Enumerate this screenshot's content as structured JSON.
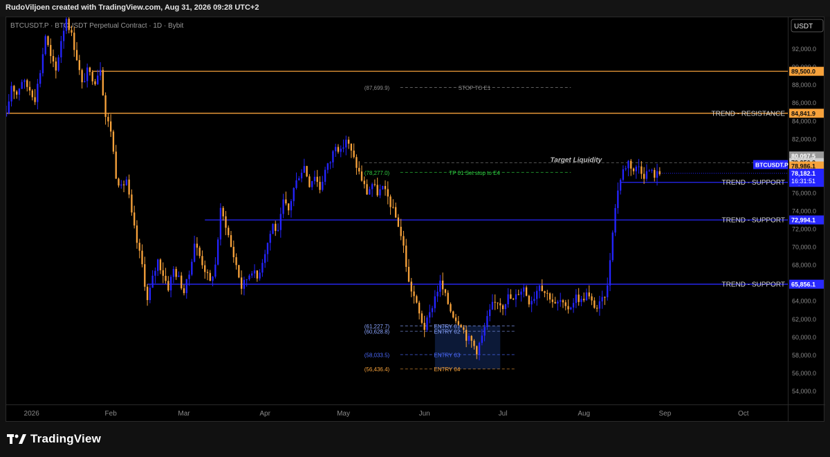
{
  "header": {
    "attribution": "RudoViljoen created with TradingView.com, Aug 31, 2026 09:28 UTC+2",
    "symbol_line": "BTCUSDT.P · BTCUSDT Perpetual Contract · 1D · Bybit"
  },
  "footer": {
    "brand": "TradingView"
  },
  "chart_data": {
    "type": "candlestick",
    "currency": "USDT",
    "ylim": [
      52500,
      95500
    ],
    "y_ticks": [
      54000,
      56000,
      58000,
      60000,
      62000,
      64000,
      66000,
      68000,
      70000,
      72000,
      74000,
      76000,
      78000,
      80000,
      82000,
      84000,
      86000,
      88000,
      90000,
      92000
    ],
    "x_labels": [
      {
        "label": "2026",
        "x": 0.7
      },
      {
        "label": "Feb",
        "x": 31
      },
      {
        "label": "Mar",
        "x": 59
      },
      {
        "label": "Apr",
        "x": 90
      },
      {
        "label": "May",
        "x": 120
      },
      {
        "label": "Jun",
        "x": 151
      },
      {
        "label": "Jul",
        "x": 181
      },
      {
        "label": "Aug",
        "x": 212
      },
      {
        "label": "Sep",
        "x": 243
      },
      {
        "label": "Oct",
        "x": 273
      }
    ],
    "x_range": [
      -9,
      290
    ],
    "last_bar_x": 241,
    "colors": {
      "up": "#2424ff",
      "down": "#f7a23b",
      "resistance": "#f7a23b",
      "support": "#2929ff"
    },
    "price_path": [
      [
        -9,
        84500
      ],
      [
        -7,
        88000
      ],
      [
        -5,
        87000
      ],
      [
        -3,
        88500
      ],
      [
        0,
        87500
      ],
      [
        2,
        86500
      ],
      [
        4,
        89500
      ],
      [
        6,
        93500
      ],
      [
        8,
        91000
      ],
      [
        10,
        89500
      ],
      [
        12,
        93000
      ],
      [
        14,
        95500
      ],
      [
        16,
        93500
      ],
      [
        18,
        91000
      ],
      [
        20,
        88000
      ],
      [
        22,
        89500
      ],
      [
        25,
        88500
      ],
      [
        27,
        90000
      ],
      [
        29,
        84500
      ],
      [
        31,
        83000
      ],
      [
        33,
        78000
      ],
      [
        35,
        76500
      ],
      [
        37,
        77500
      ],
      [
        39,
        73500
      ],
      [
        41,
        70500
      ],
      [
        43,
        68000
      ],
      [
        45,
        64000
      ],
      [
        47,
        66500
      ],
      [
        49,
        68500
      ],
      [
        51,
        67000
      ],
      [
        53,
        65500
      ],
      [
        55,
        67500
      ],
      [
        57,
        66500
      ],
      [
        59,
        65000
      ],
      [
        61,
        67000
      ],
      [
        63,
        70500
      ],
      [
        65,
        69000
      ],
      [
        67,
        67500
      ],
      [
        69,
        66000
      ],
      [
        71,
        68000
      ],
      [
        73,
        74000
      ],
      [
        75,
        72500
      ],
      [
        77,
        70000
      ],
      [
        79,
        68000
      ],
      [
        81,
        65500
      ],
      [
        83,
        66500
      ],
      [
        85,
        67500
      ],
      [
        87,
        66500
      ],
      [
        89,
        68500
      ],
      [
        91,
        70500
      ],
      [
        93,
        72500
      ],
      [
        95,
        71500
      ],
      [
        97,
        75000
      ],
      [
        99,
        74000
      ],
      [
        101,
        76500
      ],
      [
        103,
        78000
      ],
      [
        105,
        79000
      ],
      [
        107,
        77000
      ],
      [
        109,
        78000
      ],
      [
        111,
        76500
      ],
      [
        113,
        78500
      ],
      [
        115,
        79500
      ],
      [
        117,
        81500
      ],
      [
        119,
        80500
      ],
      [
        121,
        82000
      ],
      [
        123,
        80500
      ],
      [
        125,
        79000
      ],
      [
        127,
        77500
      ],
      [
        129,
        76000
      ],
      [
        131,
        77000
      ],
      [
        133,
        76000
      ],
      [
        135,
        76500
      ],
      [
        137,
        75500
      ],
      [
        139,
        74000
      ],
      [
        141,
        72500
      ],
      [
        143,
        70000
      ],
      [
        145,
        66000
      ],
      [
        147,
        64500
      ],
      [
        149,
        62500
      ],
      [
        151,
        61000
      ],
      [
        153,
        62500
      ],
      [
        155,
        64500
      ],
      [
        157,
        66000
      ],
      [
        159,
        64500
      ],
      [
        161,
        63000
      ],
      [
        163,
        62000
      ],
      [
        165,
        61500
      ],
      [
        167,
        60000
      ],
      [
        169,
        59500
      ],
      [
        171,
        58500
      ],
      [
        173,
        60000
      ],
      [
        175,
        62000
      ],
      [
        177,
        63500
      ],
      [
        179,
        64000
      ],
      [
        181,
        63500
      ],
      [
        183,
        64500
      ],
      [
        185,
        64000
      ],
      [
        187,
        65000
      ],
      [
        189,
        65500
      ],
      [
        191,
        64000
      ],
      [
        193,
        64500
      ],
      [
        195,
        66000
      ],
      [
        197,
        65000
      ],
      [
        199,
        64500
      ],
      [
        201,
        63500
      ],
      [
        203,
        64000
      ],
      [
        205,
        63000
      ],
      [
        207,
        63500
      ],
      [
        209,
        64500
      ],
      [
        211,
        64000
      ],
      [
        213,
        64800
      ],
      [
        215,
        63800
      ],
      [
        217,
        63200
      ],
      [
        219,
        64000
      ],
      [
        221,
        65500
      ],
      [
        223,
        72000
      ],
      [
        225,
        76500
      ],
      [
        227,
        78500
      ],
      [
        229,
        79500
      ],
      [
        231,
        78500
      ],
      [
        233,
        79000
      ],
      [
        235,
        78000
      ],
      [
        237,
        78500
      ],
      [
        239,
        78000
      ],
      [
        241,
        78182.1
      ]
    ],
    "levels": [
      {
        "label": "",
        "price": 89500.0,
        "price_label": "89,500.0",
        "color": "#f7a23b",
        "x_start": 24
      },
      {
        "label": "TREND - RESISTANCE",
        "price": 84841.9,
        "price_label": "84,841.9",
        "color": "#f7a23b",
        "x_start": -9
      },
      {
        "label": "TREND - SUPPORT",
        "price": 77167.8,
        "price_label": "77,167.8",
        "color": "#2929ff",
        "x_start": 226
      },
      {
        "label": "TREND - SUPPORT",
        "price": 72994.1,
        "price_label": "72,994.1",
        "color": "#2929ff",
        "x_start": 67
      },
      {
        "label": "TREND - SUPPORT",
        "price": 65856.1,
        "price_label": "65,856.1",
        "color": "#2929ff",
        "x_start": 45
      }
    ],
    "price_badges": [
      {
        "price": 80097.5,
        "label": "80,097.5",
        "bg": "#9a9a9a",
        "fg": "#ffffff"
      },
      {
        "price": 79356.3,
        "label": "79,356.3",
        "bg": "#cfcfcf",
        "fg": "#111111"
      },
      {
        "price": 78986.1,
        "label": "78,986.1",
        "bg": "#f7a23b",
        "fg": "#111111"
      }
    ],
    "current": {
      "symbol": "BTCUSDT.P",
      "price": 78182.1,
      "price_label": "78,182.1",
      "countdown": "16:31:51",
      "bg": "#2424ff"
    },
    "annotations": [
      {
        "label": "STOP TO E1",
        "value_label": "(87,699.9)",
        "price": 87699.9,
        "x1": 128,
        "x2": 207,
        "color": "#8a8a8a"
      },
      {
        "label": "TP 01 Set stop to E4",
        "value_label": "(78,277.0)",
        "price": 78277.0,
        "x1": 128,
        "x2": 207,
        "color": "#2ecc40"
      },
      {
        "label": "ENTRY 01",
        "value_label": "(61,227.7)",
        "price": 61227.7,
        "x1": 128,
        "x2": 186,
        "color": "#8aa4ff"
      },
      {
        "label": "ENTRY 02",
        "value_label": "(60,628.8)",
        "price": 60628.8,
        "x1": 128,
        "x2": 186,
        "color": "#8aa4ff"
      },
      {
        "label": "ENTRY 03",
        "value_label": "(58,033.5)",
        "price": 58033.5,
        "x1": 128,
        "x2": 186,
        "color": "#4d6bff"
      },
      {
        "label": "ENTRY 04",
        "value_label": "(56,436.4)",
        "price": 56436.4,
        "x1": 128,
        "x2": 186,
        "color": "#f7a23b"
      }
    ],
    "target_liquidity": {
      "label": "Target Liquidity",
      "price": 79356.3,
      "x1": 128,
      "x2": 249
    },
    "entry_box": {
      "x1": 155,
      "x2": 180,
      "y_top": 61227.7,
      "y_bottom": 56436.4,
      "color": "#0d1a3a"
    }
  }
}
